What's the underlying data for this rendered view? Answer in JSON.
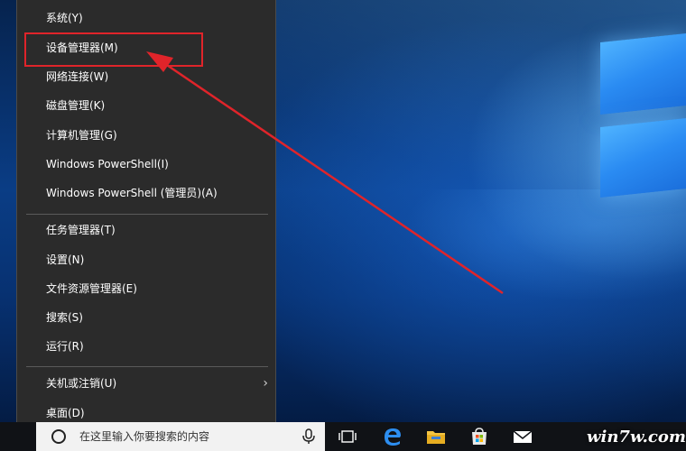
{
  "menu": {
    "items": [
      {
        "label": "系统(Y)"
      },
      {
        "label": "设备管理器(M)"
      },
      {
        "label": "网络连接(W)"
      },
      {
        "label": "磁盘管理(K)"
      },
      {
        "label": "计算机管理(G)"
      },
      {
        "label": "Windows PowerShell(I)"
      },
      {
        "label": "Windows PowerShell (管理员)(A)"
      },
      {
        "label": "任务管理器(T)"
      },
      {
        "label": "设置(N)"
      },
      {
        "label": "文件资源管理器(E)"
      },
      {
        "label": "搜索(S)"
      },
      {
        "label": "运行(R)"
      },
      {
        "label": "关机或注销(U)",
        "has_submenu": true,
        "submenu_glyph": "›"
      },
      {
        "label": "桌面(D)"
      }
    ]
  },
  "taskbar": {
    "search_placeholder": "在这里输入你要搜索的内容",
    "icons": [
      "task-view-icon",
      "edge-icon",
      "file-explorer-icon",
      "store-icon",
      "mail-icon"
    ]
  },
  "watermark": "win7w.com",
  "colors": {
    "menu_bg": "#2b2b2b",
    "highlight": "#e0242a",
    "taskbar_bg": "#101216"
  }
}
